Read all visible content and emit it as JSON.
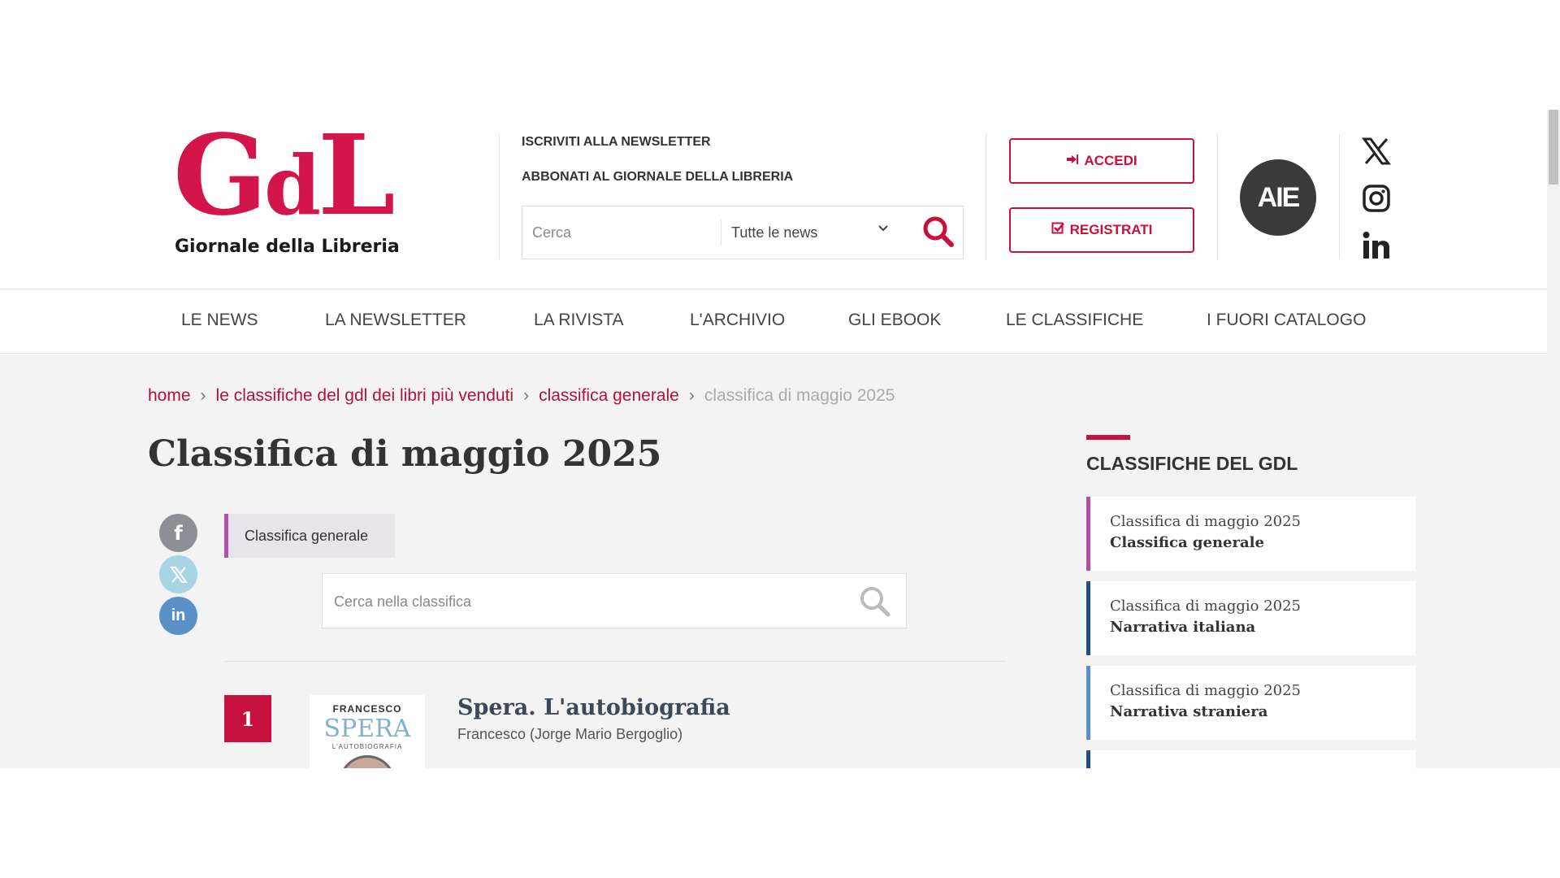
{
  "logo": {
    "mark_g": "G",
    "mark_d": "d",
    "mark_l": "L",
    "subtitle": "Giornale della Libreria"
  },
  "top_links": {
    "newsletter": "ISCRIVITI ALLA NEWSLETTER",
    "subscribe": "ABBONATI AL GIORNALE DELLA LIBRERIA"
  },
  "search": {
    "placeholder": "Cerca",
    "scope": "Tutte le news"
  },
  "account": {
    "login": "ACCEDI",
    "register": "REGISTRATI"
  },
  "aie": {
    "label": "AIE"
  },
  "social": [
    "x-icon",
    "instagram-icon",
    "linkedin-icon"
  ],
  "nav": [
    "LE NEWS",
    "LA NEWSLETTER",
    "LA RIVISTA",
    "L'ARCHIVIO",
    "GLI EBOOK",
    "LE CLASSIFICHE",
    "I FUORI CATALOGO"
  ],
  "breadcrumb": {
    "home": "home",
    "level1": "le classifiche del gdl dei libri più venduti",
    "level2": "classifica generale",
    "current": "classifica di maggio 2025"
  },
  "page_title": "Classifica di maggio 2025",
  "share": {
    "facebook_glyph": "f",
    "linkedin_glyph": "in"
  },
  "ranking": {
    "tab": "Classifica generale",
    "search_placeholder": "Cerca nella classifica",
    "items": [
      {
        "rank": "1",
        "title": "Spera. L'autobiografia",
        "author": "Francesco (Jorge Mario Bergoglio)",
        "cover_author": "FRANCESCO",
        "cover_title": "SPERA",
        "cover_subtitle": "L'AUTOBIOGRAFIA"
      }
    ]
  },
  "sidebar": {
    "title": "CLASSIFICHE DEL GDL",
    "cards": [
      {
        "line1": "Classifica di maggio 2025",
        "line2": "Classifica generale",
        "accent": "#b34fa8"
      },
      {
        "line1": "Classifica di maggio 2025",
        "line2": "Narrativa italiana",
        "accent": "#1f4f86"
      },
      {
        "line1": "Classifica di maggio 2025",
        "line2": "Narrativa straniera",
        "accent": "#5a8fc8"
      }
    ]
  },
  "colors": {
    "brand": "#d4154a",
    "link": "#b31238",
    "facebook": "#8c9095",
    "x": "#a8d4e6",
    "linkedin": "#5a8fc8"
  }
}
